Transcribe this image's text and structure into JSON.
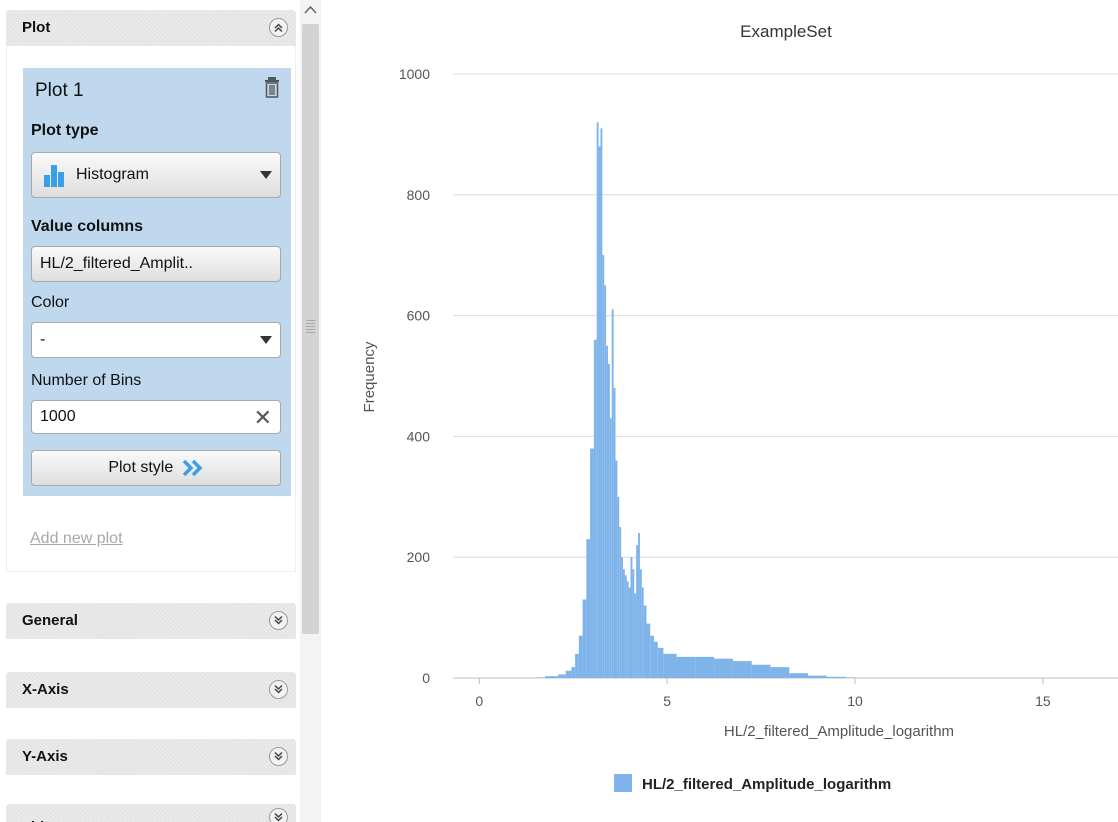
{
  "sections": {
    "plot": "Plot",
    "general": "General",
    "x_axis": "X-Axis",
    "y_axis": "Y-Axis",
    "title": "Title"
  },
  "plot_card": {
    "title": "Plot 1",
    "plot_type_label": "Plot type",
    "plot_type_value": "Histogram",
    "value_columns_label": "Value columns",
    "value_columns_value": "HL/2_filtered_Amplit..",
    "color_label": "Color",
    "color_value": "-",
    "bins_label": "Number of Bins",
    "bins_value": "1000",
    "plot_style_label": "Plot style"
  },
  "add_new_plot": "Add new plot",
  "icons": {
    "collapse": "double-chevron-up-icon",
    "expand": "double-chevron-down-icon",
    "delete": "trash-icon",
    "histogram": "histogram-icon",
    "clear": "clear-x-icon",
    "plot_style": "double-chevron-right-icon",
    "scroll_up": "chevron-up-icon"
  },
  "colors": {
    "accent": "#3a9ee8",
    "bar": "#7eb4ea",
    "card": "#bfd8ee"
  },
  "chart_data": {
    "type": "bar",
    "title": "ExampleSet",
    "xlabel": "HL/2_filtered_Amplitude_logarithm",
    "ylabel": "Frequency",
    "xlim": [
      -0.7,
      17
    ],
    "ylim": [
      0,
      1000
    ],
    "x_ticks": [
      0,
      5,
      10,
      15
    ],
    "y_ticks": [
      0,
      200,
      400,
      600,
      800,
      1000
    ],
    "grid": true,
    "legend": "bottom",
    "series": [
      {
        "name": "HL/2_filtered_Amplitude_logarithm",
        "color": "#7eb4ea",
        "x": [
          1.5,
          2.0,
          2.2,
          2.4,
          2.5,
          2.6,
          2.7,
          2.8,
          2.9,
          3.0,
          3.1,
          3.15,
          3.2,
          3.25,
          3.3,
          3.35,
          3.4,
          3.45,
          3.5,
          3.55,
          3.6,
          3.65,
          3.7,
          3.75,
          3.8,
          3.85,
          3.9,
          3.95,
          4.0,
          4.05,
          4.1,
          4.15,
          4.2,
          4.25,
          4.3,
          4.35,
          4.4,
          4.5,
          4.6,
          4.7,
          4.8,
          5.0,
          5.5,
          6.0,
          6.5,
          7.0,
          7.5,
          8.0,
          8.5,
          9.0,
          9.5,
          10.0
        ],
        "y": [
          1,
          3,
          6,
          12,
          18,
          40,
          70,
          130,
          230,
          380,
          560,
          920,
          880,
          910,
          700,
          650,
          550,
          520,
          430,
          610,
          480,
          360,
          300,
          250,
          200,
          180,
          170,
          160,
          150,
          200,
          180,
          140,
          220,
          240,
          180,
          150,
          120,
          90,
          70,
          60,
          50,
          40,
          35,
          35,
          32,
          28,
          22,
          18,
          8,
          4,
          2,
          1
        ]
      }
    ]
  }
}
